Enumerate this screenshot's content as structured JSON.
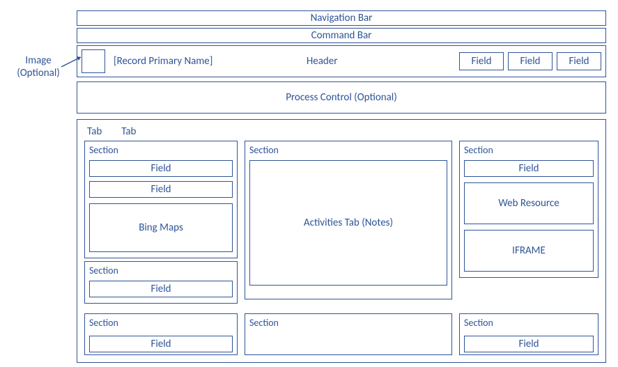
{
  "annotation": {
    "line1": "Image",
    "line2": "(Optional)"
  },
  "nav_bar": "Navigation Bar",
  "command_bar": "Command Bar",
  "header": {
    "record_primary_name": "[Record Primary Name]",
    "title": "Header",
    "fields": [
      "Field",
      "Field",
      "Field"
    ]
  },
  "process_control": "Process Control (Optional)",
  "tabs": [
    "Tab",
    "Tab"
  ],
  "left_col": {
    "section1": {
      "label": "Section",
      "field1": "Field",
      "field2": "Field",
      "bing_maps": "Bing Maps"
    },
    "section2": {
      "label": "Section",
      "field1": "Field"
    }
  },
  "mid_col": {
    "section1": {
      "label": "Section",
      "activities": "Activities Tab (Notes)"
    }
  },
  "right_col": {
    "section1": {
      "label": "Section",
      "field1": "Field",
      "web_resource": "Web Resource",
      "iframe": "IFRAME"
    }
  },
  "bottom_row": {
    "s1": {
      "label": "Section",
      "field": "Field"
    },
    "s2": {
      "label": "Section"
    },
    "s3": {
      "label": "Section",
      "field": "Field"
    }
  }
}
